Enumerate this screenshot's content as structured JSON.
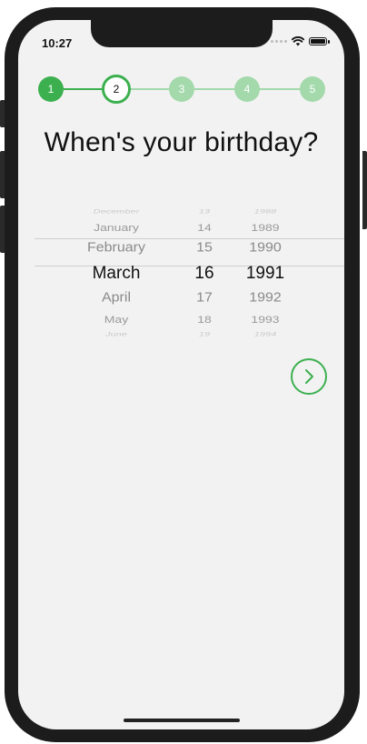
{
  "status_bar": {
    "time": "10:27"
  },
  "stepper": {
    "steps": [
      {
        "label": "1",
        "state": "done"
      },
      {
        "label": "2",
        "state": "current"
      },
      {
        "label": "3",
        "state": "todo"
      },
      {
        "label": "4",
        "state": "todo"
      },
      {
        "label": "5",
        "state": "todo"
      }
    ],
    "accent_color": "#3cb04f",
    "faded_color": "#a3d9ab"
  },
  "title": "When's your birthday?",
  "picker": {
    "rows": [
      {
        "month": "December",
        "day": "13",
        "year": "1988"
      },
      {
        "month": "January",
        "day": "14",
        "year": "1989"
      },
      {
        "month": "February",
        "day": "15",
        "year": "1990"
      },
      {
        "month": "March",
        "day": "16",
        "year": "1991"
      },
      {
        "month": "April",
        "day": "17",
        "year": "1992"
      },
      {
        "month": "May",
        "day": "18",
        "year": "1993"
      },
      {
        "month": "June",
        "day": "19",
        "year": "1994"
      }
    ],
    "selected_index": 3
  },
  "next_button": {
    "icon": "chevron-right-icon"
  }
}
